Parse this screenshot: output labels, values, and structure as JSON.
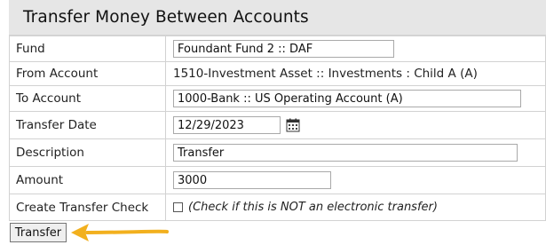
{
  "title": "Transfer Money Between Accounts",
  "fields": {
    "fund": {
      "label": "Fund",
      "value": "Foundant Fund 2 :: DAF"
    },
    "from_account": {
      "label": "From Account",
      "value": "1510-Investment Asset :: Investments : Child A (A)"
    },
    "to_account": {
      "label": "To Account",
      "value": "1000-Bank :: US Operating Account (A)"
    },
    "transfer_date": {
      "label": "Transfer Date",
      "value": "12/29/2023",
      "icon": "calendar-icon"
    },
    "description": {
      "label": "Description",
      "value": "Transfer"
    },
    "amount": {
      "label": "Amount",
      "value": "3000"
    },
    "create_check": {
      "label": "Create Transfer Check",
      "checked": false,
      "note": "(Check if this is NOT an electronic transfer)"
    }
  },
  "transfer_button": {
    "label": "Transfer"
  },
  "colors": {
    "header_bg": "#e6e6e6",
    "arrow": "#f2b01e"
  }
}
